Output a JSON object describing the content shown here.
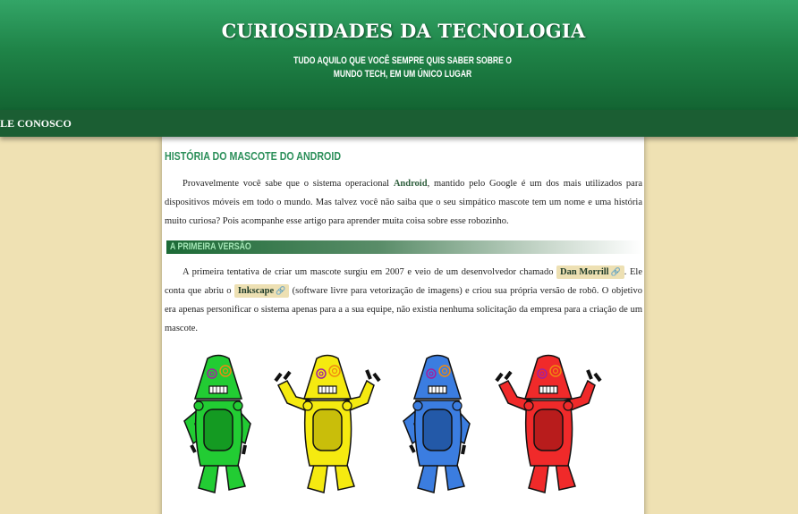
{
  "site": {
    "title": "CURIOSIDADES DA TECNOLOGIA",
    "subtitle": "TUDO AQUILO QUE VOCÊ SEMPRE QUIS SABER SOBRE O MUNDO TECH, EM UM ÚNICO LUGAR"
  },
  "nav": {
    "contact_label": "FALE CONOSCO"
  },
  "article": {
    "title": "HISTÓRIA DO MASCOTE DO ANDROID",
    "intro": {
      "before": "Provavelmente você sabe que o sistema operacional ",
      "bold": "Android",
      "after": ", mantido pelo Google é um dos mais utilizados para dispositivos móveis em todo o mundo. Mas talvez você não saiba que o seu simpático mascote tem um nome e uma história muito curiosa? Pois acompanhe esse artigo para aprender muita coisa sobre esse robozinho."
    },
    "section1": {
      "title": "A PRIMEIRA VERSÃO",
      "p_before": "A primeira tentativa de criar um mascote surgiu em 2007 e veio de um desenvolvedor chamado ",
      "link1": "Dan Morrill",
      "p_middle": ". Ele conta que abriu o ",
      "link2": "Inkscape",
      "p_after": " (software livre para vetorização de imagens) e criou sua própria versão de robô. O objetivo era apenas personificar o sistema apenas para a a sua equipe, não existia nenhuma solicitação da empresa para a criação de um mascote.",
      "link_icon": "link-icon"
    },
    "robots": {
      "colors": [
        "#22cc33",
        "#f5ea10",
        "#3b7de0",
        "#f02a2a"
      ],
      "dark_colors": [
        "#149a22",
        "#c9be0a",
        "#2359a8",
        "#b81c1c"
      ]
    }
  },
  "colors": {
    "header_top": "#33a567",
    "header_bottom": "#136432",
    "nav": "#1b5e33",
    "page_bg": "#efe1b3",
    "accent_title": "#2c8f5a"
  }
}
